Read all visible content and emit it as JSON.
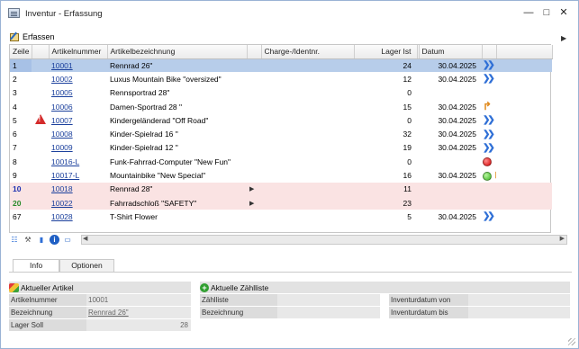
{
  "window": {
    "title": "Inventur - Erfassung",
    "minimize_glyph": "—",
    "maximize_glyph": "□",
    "close_glyph": "✕"
  },
  "toolbar": {
    "erfassen_label": "Erfassen",
    "scroll_right_glyph": "▶"
  },
  "grid": {
    "columns": [
      "Zeile",
      "",
      "Artikelnummer",
      "Artikelbezeichnung",
      "",
      "Charge-/Identnr.",
      "Lager Ist",
      "",
      "Datum",
      "",
      ""
    ],
    "rows": [
      {
        "zeile": "1",
        "warn": false,
        "artnr": "10001",
        "bez": "Rennrad 26\"",
        "marker": "",
        "charge": "",
        "lager": "24",
        "datum": "30.04.2025",
        "status": "dbl-arrow",
        "style": "sel",
        "zeile_style": ""
      },
      {
        "zeile": "2",
        "warn": false,
        "artnr": "10002",
        "bez": "Luxus Mountain Bike \"oversized\"",
        "marker": "",
        "charge": "",
        "lager": "12",
        "datum": "30.04.2025",
        "status": "dbl-arrow",
        "style": "",
        "zeile_style": ""
      },
      {
        "zeile": "3",
        "warn": false,
        "artnr": "10005",
        "bez": "Rennsportrad 28\"",
        "marker": "",
        "charge": "",
        "lager": "0",
        "datum": "",
        "status": "",
        "style": "",
        "zeile_style": ""
      },
      {
        "zeile": "4",
        "warn": false,
        "artnr": "10006",
        "bez": "Damen-Sportrad 28 \"",
        "marker": "",
        "charge": "",
        "lager": "15",
        "datum": "30.04.2025",
        "status": "return-arrow",
        "style": "",
        "zeile_style": ""
      },
      {
        "zeile": "5",
        "warn": true,
        "artnr": "10007",
        "bez": "Kindergeländerad \"Off Road\"",
        "marker": "",
        "charge": "",
        "lager": "0",
        "datum": "30.04.2025",
        "status": "dbl-arrow",
        "style": "",
        "zeile_style": ""
      },
      {
        "zeile": "6",
        "warn": false,
        "artnr": "10008",
        "bez": "Kinder-Spielrad 16 \"",
        "marker": "",
        "charge": "",
        "lager": "32",
        "datum": "30.04.2025",
        "status": "dbl-arrow",
        "style": "",
        "zeile_style": ""
      },
      {
        "zeile": "7",
        "warn": false,
        "artnr": "10009",
        "bez": "Kinder-Spielrad 12 \"",
        "marker": "",
        "charge": "",
        "lager": "19",
        "datum": "30.04.2025",
        "status": "dbl-arrow",
        "style": "",
        "zeile_style": ""
      },
      {
        "zeile": "8",
        "warn": false,
        "artnr": "10016-L",
        "bez": "Funk-Fahrrad-Computer \"New Fun\"",
        "marker": "",
        "charge": "",
        "lager": "0",
        "datum": "",
        "status": "red-dot",
        "style": "",
        "zeile_style": ""
      },
      {
        "zeile": "9",
        "warn": false,
        "artnr": "10017-L",
        "bez": "Mountainbike \"New Special\"",
        "marker": "",
        "charge": "",
        "lager": "16",
        "datum": "30.04.2025",
        "status": "green-dot-return",
        "style": "",
        "zeile_style": ""
      },
      {
        "zeile": "10",
        "warn": false,
        "artnr": "10018",
        "bez": "Rennrad 28\"",
        "marker": "▶",
        "charge": "",
        "lager": "11",
        "datum": "",
        "status": "",
        "style": "pink",
        "zeile_style": "blue"
      },
      {
        "zeile": "20",
        "warn": false,
        "artnr": "10022",
        "bez": "Fahrradschloß \"SAFETY\"",
        "marker": "▶",
        "charge": "",
        "lager": "23",
        "datum": "",
        "status": "",
        "style": "pink",
        "zeile_style": "green"
      },
      {
        "zeile": "67",
        "warn": false,
        "artnr": "10028",
        "bez": "T-Shirt Flower",
        "marker": "",
        "charge": "",
        "lager": "5",
        "datum": "30.04.2025",
        "status": "dbl-arrow",
        "style": "",
        "zeile_style": ""
      }
    ]
  },
  "tabs": [
    {
      "label": "Info",
      "active": true
    },
    {
      "label": "Optionen",
      "active": false
    }
  ],
  "aktueller_artikel": {
    "title": "Aktueller Artikel",
    "fields": [
      {
        "label": "Artikelnummer",
        "value": "10001"
      },
      {
        "label": "Bezeichnung",
        "value": "Rennrad 26\""
      },
      {
        "label": "Lager Soll",
        "value": "28"
      }
    ]
  },
  "aktuelle_zaehlliste": {
    "title": "Aktuelle Zählliste",
    "fields_left": [
      {
        "label": "Zählliste",
        "value": ""
      },
      {
        "label": "Bezeichnung",
        "value": ""
      }
    ],
    "fields_right": [
      {
        "label": "Inventurdatum von",
        "value": ""
      },
      {
        "label": "Inventurdatum bis",
        "value": ""
      }
    ]
  },
  "colors": {
    "selected_row": "#b7cdea",
    "pink_row": "#fae3e3",
    "link": "#1a3f9c",
    "arrow_blue": "#2f6fd6",
    "arrow_orange": "#e08a1e"
  }
}
